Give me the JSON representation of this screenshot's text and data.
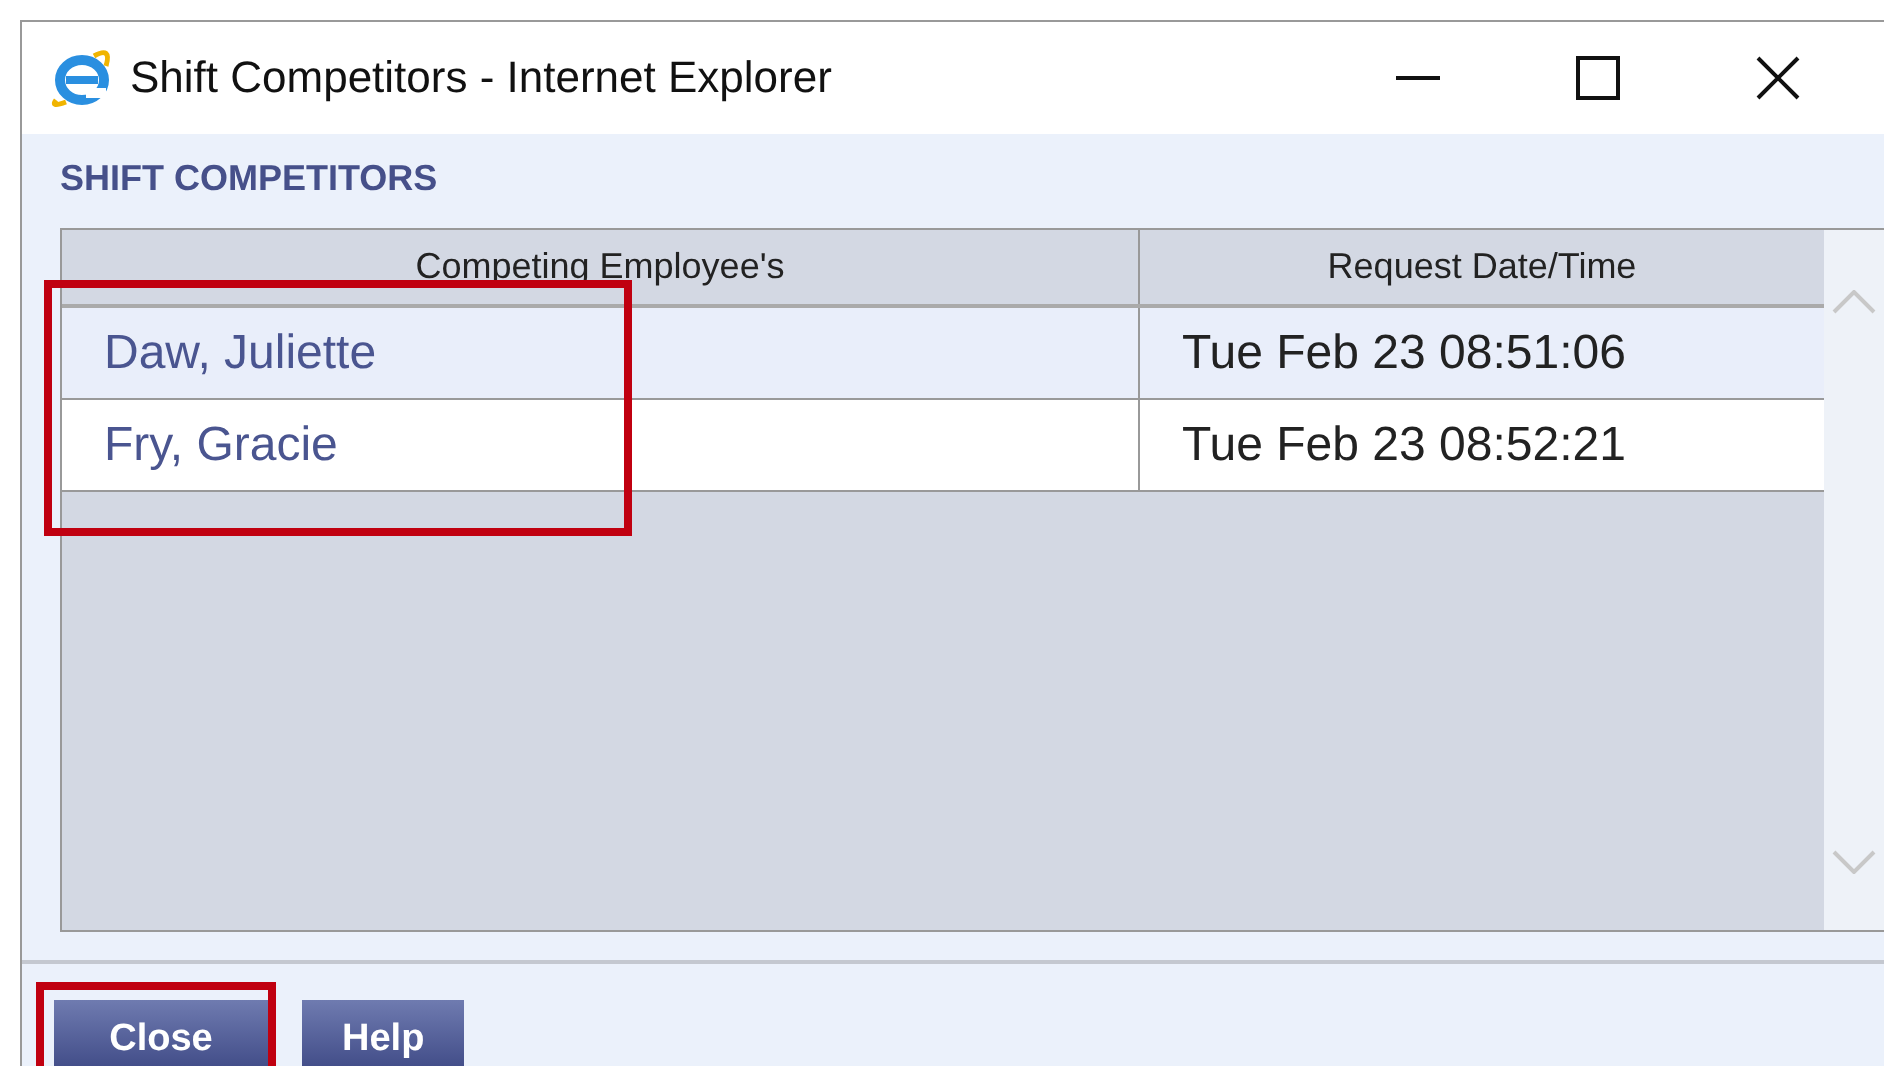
{
  "window": {
    "title": "Shift Competitors - Internet Explorer"
  },
  "heading": "SHIFT COMPETITORS",
  "table": {
    "columns": [
      "Competing Employee's",
      "Request Date/Time"
    ],
    "name_column_highlighted": true,
    "rows": [
      {
        "name": "Daw, Juliette",
        "time": "Tue Feb 23 08:51:06"
      },
      {
        "name": "Fry, Gracie",
        "time": "Tue Feb 23 08:52:21"
      }
    ]
  },
  "buttons": [
    {
      "label": "Close",
      "highlighted": true
    },
    {
      "label": "Help",
      "highlighted": false
    }
  ]
}
